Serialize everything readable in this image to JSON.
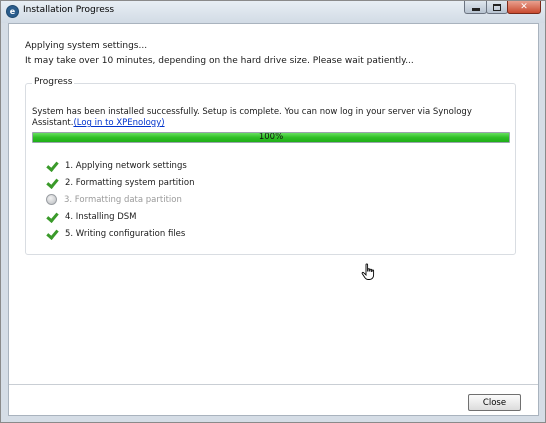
{
  "window": {
    "title": "Installation Progress",
    "app_icon_glyph": "e"
  },
  "header": {
    "heading": "Applying system settings...",
    "subheading": "It may take over 10 minutes, depending on the hard drive size. Please wait patiently..."
  },
  "progress_group": {
    "label": "Progress",
    "status_message": "System has been installed successfully. Setup is complete. You can now log in your server via Synology Assistant.",
    "link_text": "(Log in to XPEnology)",
    "progress_value": 100,
    "progress_text": "100%",
    "steps": [
      {
        "label": "1. Applying network settings",
        "status": "done",
        "icon": "check-icon"
      },
      {
        "label": "2. Formatting system partition",
        "status": "done",
        "icon": "check-icon"
      },
      {
        "label": "3. Formatting data partition",
        "status": "skipped",
        "icon": "pending-circle-icon"
      },
      {
        "label": "4. Installing DSM",
        "status": "done",
        "icon": "check-icon"
      },
      {
        "label": "5. Writing configuration files",
        "status": "done",
        "icon": "check-icon"
      }
    ]
  },
  "footer": {
    "close_label": "Close"
  },
  "colors": {
    "progress_green": "#2fbf27",
    "check_green": "#3a9a2a",
    "link_blue": "#0033cc",
    "close_red": "#c94a2f"
  }
}
